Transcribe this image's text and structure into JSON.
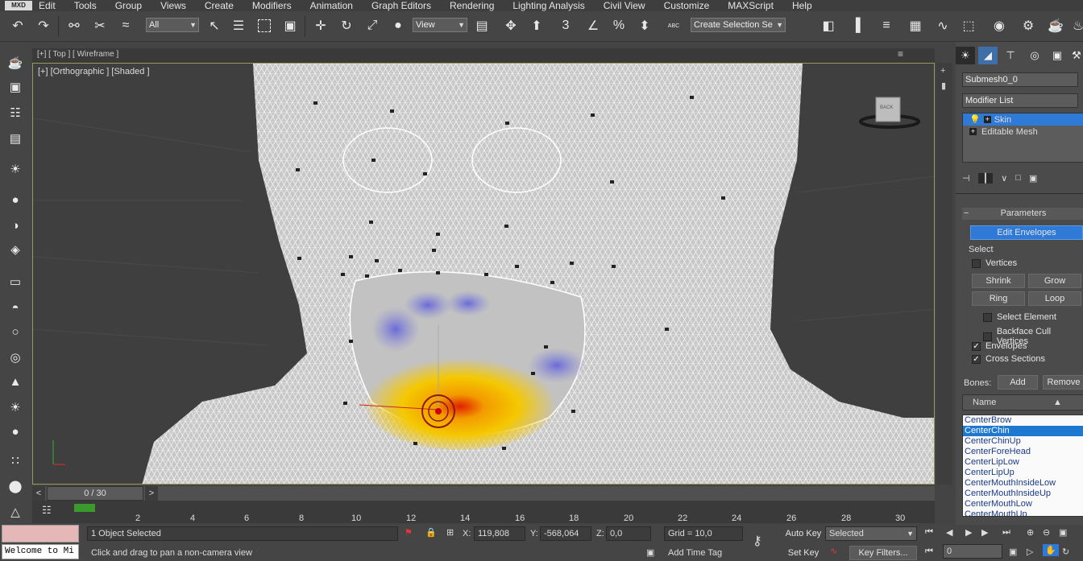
{
  "menu": [
    "Edit",
    "Tools",
    "Group",
    "Views",
    "Create",
    "Modifiers",
    "Animation",
    "Graph Editors",
    "Rendering",
    "Lighting Analysis",
    "Civil View",
    "Customize",
    "MAXScript",
    "Help"
  ],
  "menu_logo": "MXD",
  "toolbar": {
    "filter_value": "All",
    "refcoord_value": "View",
    "selection_set_value": "Create Selection Se",
    "snap_label": "3",
    "angle_label": "∠",
    "percent_label": "%",
    "abc_label": "ABC"
  },
  "viewport_top": {
    "label": "[+] [ Top ] [ Wireframe ]"
  },
  "viewport_main": {
    "label": "[+] [Orthographic ] [Shaded ]",
    "viewcube_label": "BACK"
  },
  "command_panel": {
    "object_name": "Submesh0_0",
    "modifier_list_label": "Modifier List",
    "stack": [
      {
        "label": "Skin",
        "selected": true
      },
      {
        "label": "Editable Mesh",
        "selected": false
      }
    ],
    "rollout_title": "Parameters",
    "edit_envelopes_label": "Edit Envelopes",
    "select_group_label": "Select",
    "vertices_label": "Vertices",
    "shrink_label": "Shrink",
    "grow_label": "Grow",
    "ring_label": "Ring",
    "loop_label": "Loop",
    "select_element_label": "Select Element",
    "backface_label": "Backface Cull Vertices",
    "envelopes_label": "Envelopes",
    "cross_sections_label": "Cross Sections",
    "bones_label": "Bones:",
    "add_label": "Add",
    "remove_label": "Remove",
    "name_header": "Name",
    "bones": [
      "CenterBrow",
      "CenterChin",
      "CenterChinUp",
      "CenterForeHead",
      "CenterLipLow",
      "CenterLipUp",
      "CenterMouthInsideLow",
      "CenterMouthInsideUp",
      "CenterMouthLow",
      "CenterMouthUp"
    ],
    "selected_bone": "CenterChin"
  },
  "timeline": {
    "frame_label": "0 / 30",
    "ticks": [
      "2",
      "4",
      "6",
      "8",
      "10",
      "12",
      "14",
      "16",
      "18",
      "20",
      "22",
      "24",
      "26",
      "28",
      "30"
    ]
  },
  "status": {
    "maxscript_listener": "Welcome to Mi",
    "selection_count": "1 Object Selected",
    "prompt": "Click and drag to pan a non-camera view",
    "x_label": "X:",
    "x_value": "119,808",
    "y_label": "Y:",
    "y_value": "-568,064",
    "z_label": "Z:",
    "z_value": "0,0",
    "grid_label": "Grid = 10,0",
    "add_time_tag": "Add Time Tag",
    "auto_key": "Auto Key",
    "set_key": "Set Key",
    "selected_value": "Selected",
    "key_filters": "Key Filters...",
    "current_frame": "0"
  },
  "colors": {
    "accent": "#1e78d0",
    "viewport_bg": "#3f3f3f",
    "panel_bg": "#4b4b4b"
  }
}
